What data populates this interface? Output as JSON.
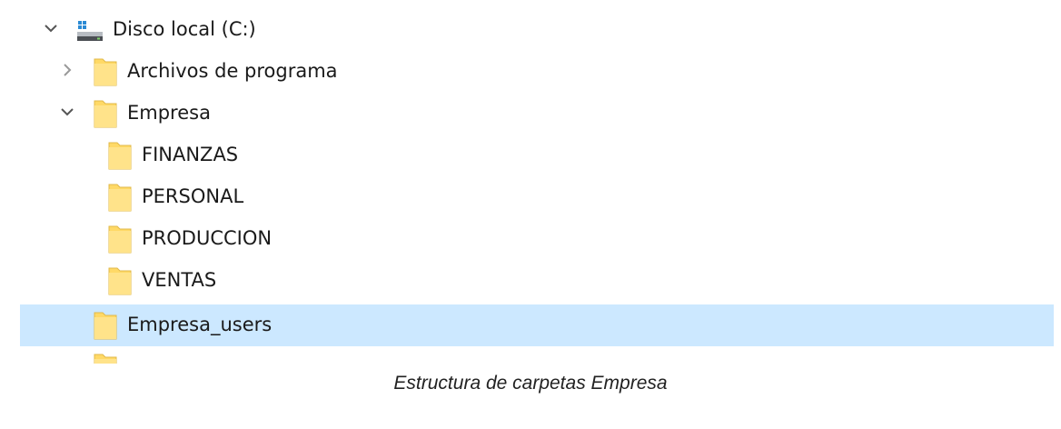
{
  "tree": {
    "drive": {
      "label": "Disco local (C:)",
      "icon": "drive-icon"
    },
    "archivos": {
      "label": "Archivos de programa",
      "icon": "folder-icon"
    },
    "empresa": {
      "label": "Empresa",
      "icon": "folder-icon",
      "children": [
        {
          "label": "FINANZAS"
        },
        {
          "label": "PERSONAL"
        },
        {
          "label": "PRODUCCION"
        },
        {
          "label": "VENTAS"
        }
      ]
    },
    "empresa_users": {
      "label": "Empresa_users",
      "icon": "folder-icon",
      "selected": true
    }
  },
  "caption": "Estructura de carpetas Empresa",
  "colors": {
    "selection": "#cce8ff",
    "folder": "#ffd966",
    "chevron": "#555555"
  }
}
